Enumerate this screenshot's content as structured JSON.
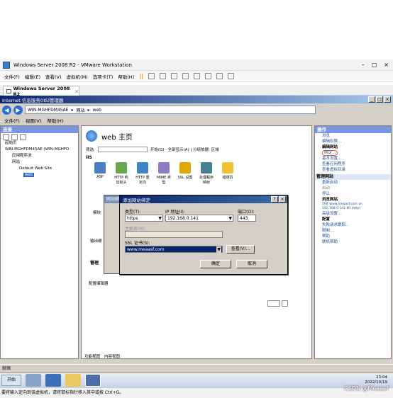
{
  "vmware": {
    "title": "Windows Server 2008 R2 - VMware Workstation",
    "menu": [
      "文件(F)",
      "编辑(E)",
      "查看(V)",
      "虚拟机(M)",
      "选项卡(T)",
      "帮助(H)"
    ],
    "tab": "Windows Server 2008 R2",
    "status": "要将输入定向到该虚拟机，请将鼠标指针移入其中或按 Ctrl+G。"
  },
  "iis": {
    "window_title": "Internet 信息服务(IIS)管理器",
    "address": [
      "WIN-MGHFDM45AE",
      "网站",
      "web"
    ],
    "menu": [
      "文件(F)",
      "视图(V)",
      "帮助(H)"
    ],
    "status": "就绪"
  },
  "connections": {
    "header": "连接",
    "tree": [
      "起始页",
      "WIN-MGHFDM45AE (WIN-MGHFD",
      "应用程序池",
      "网站",
      "Default Web Site",
      "web"
    ]
  },
  "center": {
    "title": "web 主页",
    "filter_label": "筛选:",
    "filter_actions": "开始(G) · 全部显示(A) | 分组依据: 区域",
    "section_iis": "IIS",
    "icons": [
      "ASP",
      "HTTP 响应标头",
      "HTTP 重定向",
      "MIME 类型",
      "SSL 设置",
      "处理程序映射",
      "错误页"
    ],
    "partial_labels": [
      "模块",
      "输出缓",
      "管理",
      "配置编辑器"
    ],
    "bottom_tabs": [
      "功能视图",
      "内容视图"
    ]
  },
  "actions": {
    "header": "操作",
    "items": [
      "浏览",
      "编辑权限...",
      "编辑网站",
      "绑定...",
      "基本设置...",
      "查看应用程序",
      "查看虚拟目录"
    ],
    "manage_header": "管理网站",
    "manage": [
      "重新启动",
      "启动",
      "停止"
    ],
    "browse_header": "浏览网站",
    "browse": [
      "浏览 www.meaasf.com on 192.168.0.141:80 (http)",
      "高级设置..."
    ],
    "config_header": "配置",
    "config": [
      "失败请求跟踪...",
      "限制..."
    ],
    "help": [
      "帮助",
      "联机帮助"
    ]
  },
  "bg_dialog": {
    "title": "网站绑定"
  },
  "dialog": {
    "title": "添加网站绑定",
    "type_label": "类型(T):",
    "type_value": "https",
    "ip_label": "IP 地址(I):",
    "ip_value": "192.168.0.141",
    "port_label": "端口(O):",
    "port_value": "443",
    "host_label": "主机名(H):",
    "ssl_label": "SSL 证书(S):",
    "ssl_value": "www.meaasf.com",
    "view_btn": "查看(V)...",
    "ok": "确定",
    "cancel": "取消"
  },
  "taskbar": {
    "start": "开始",
    "time": "23:04",
    "date": "2022/10/19"
  },
  "watermark": "CSDN @Meaauf"
}
